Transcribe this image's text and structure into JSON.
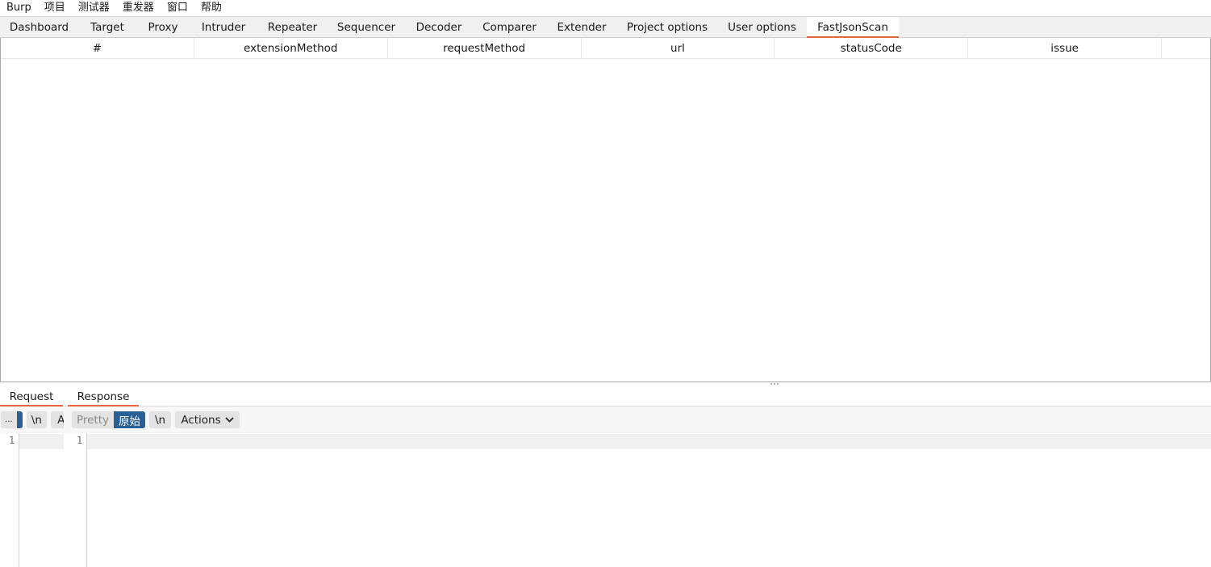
{
  "menubar": {
    "items": [
      "Burp",
      "项目",
      "测试器",
      "重发器",
      "窗口",
      "帮助"
    ]
  },
  "main_tabs": {
    "items": [
      "Dashboard",
      "Target",
      "Proxy",
      "Intruder",
      "Repeater",
      "Sequencer",
      "Decoder",
      "Comparer",
      "Extender",
      "Project options",
      "User options",
      "FastJsonScan"
    ],
    "active": "FastJsonScan",
    "accent_color": "#e8663d"
  },
  "results_table": {
    "columns": [
      "#",
      "extensionMethod",
      "requestMethod",
      "url",
      "statusCode",
      "issue"
    ],
    "rows": []
  },
  "bottom_tabs": {
    "request_label": "Request",
    "response_label": "Response"
  },
  "request_toolbar": {
    "collapsed_label": "...",
    "newline_label": "\\n",
    "truncated_label": "A"
  },
  "response_toolbar": {
    "pretty_label": "Pretty",
    "raw_label": "原始",
    "newline_label": "\\n",
    "actions_label": "Actions",
    "selected_color": "#2a5f96"
  },
  "request_editor": {
    "line_number": "1"
  },
  "response_editor": {
    "line_number": "1"
  }
}
